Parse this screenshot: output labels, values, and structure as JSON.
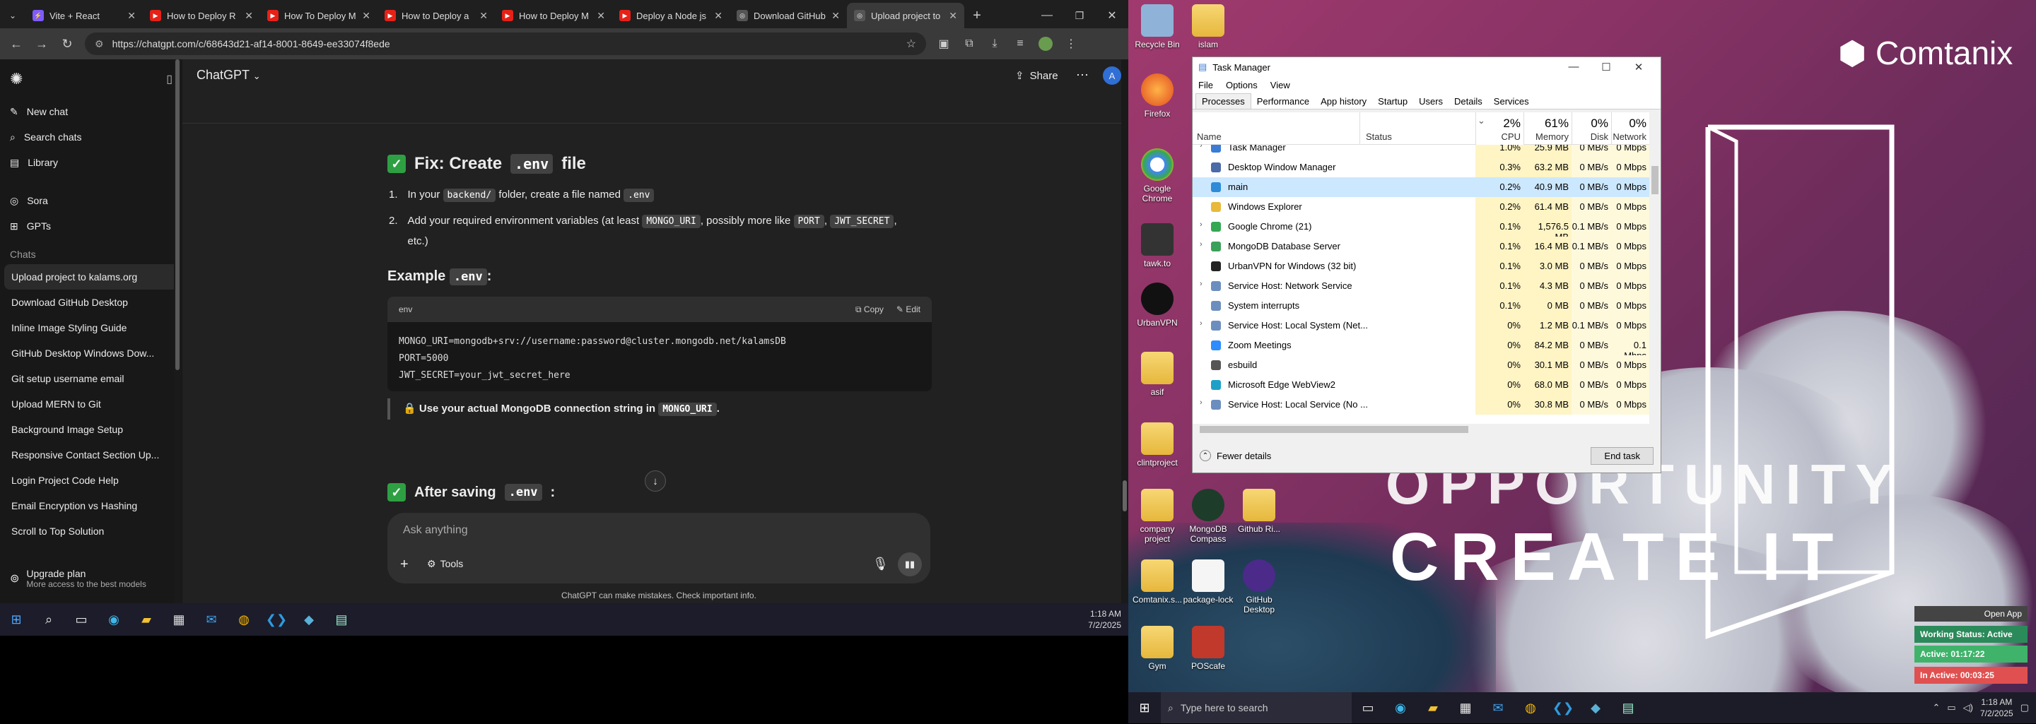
{
  "browser": {
    "tabs": [
      {
        "title": "Vite + React",
        "fav": "vite-icon"
      },
      {
        "title": "How to Deploy R",
        "fav": "youtube-icon"
      },
      {
        "title": "How To Deploy M",
        "fav": "youtube-icon"
      },
      {
        "title": "How to Deploy a",
        "fav": "youtube-icon"
      },
      {
        "title": "How to Deploy M",
        "fav": "youtube-icon"
      },
      {
        "title": "Deploy a Node js",
        "fav": "youtube-icon"
      },
      {
        "title": "Download GitHub",
        "fav": "chatgpt-icon"
      },
      {
        "title": "Upload project to",
        "fav": "chatgpt-icon"
      }
    ],
    "url": "https://chatgpt.com/c/68643d21-af14-8001-8649-ee33074f8ede"
  },
  "sidebar": {
    "new_chat": "New chat",
    "search": "Search chats",
    "library": "Library",
    "sora": "Sora",
    "gpts": "GPTs",
    "chats_heading": "Chats",
    "chats": [
      "Upload project to kalams.org",
      "Download GitHub Desktop",
      "Inline Image Styling Guide",
      "GitHub Desktop Windows Dow...",
      "Git setup username email",
      "Upload MERN to Git",
      "Background Image Setup",
      "Responsive Contact Section Up...",
      "Login Project Code Help",
      "Email Encryption vs Hashing",
      "Scroll to Top Solution"
    ],
    "upgrade_title": "Upgrade plan",
    "upgrade_sub": "More access to the best models"
  },
  "main": {
    "model": "ChatGPT",
    "share": "Share",
    "avatar": "A",
    "fix_title_pre": "Fix: Create",
    "fix_title_code": ".env",
    "fix_title_post": "file",
    "step1_pre": "In your",
    "step1_code": "backend/",
    "step1_mid": "folder, create a file named",
    "step1_code2": ".env",
    "step2_pre": "Add your required environment variables (at least",
    "step2_code1": "MONGO_URI",
    "step2_mid": ", possibly more like",
    "step2_code2": "PORT",
    "step2_code3": "JWT_SECRET",
    "step2_post": ",",
    "step2_cont": "etc.)",
    "example_pre": "Example",
    "example_code": ".env",
    "example_post": ":",
    "code_lang": "env",
    "copy": "Copy",
    "edit": "Edit",
    "code_lines": [
      "MONGO_URI=mongodb+srv://username:password@cluster.mongodb.net/kalamsDB",
      "PORT=5000",
      "JWT_SECRET=your_jwt_secret_here"
    ],
    "note_pre": "Use your actual MongoDB connection string in",
    "note_code": "MONGO_URI",
    "note_post": ".",
    "after_pre": "After saving",
    "after_code": ".env",
    "after_post": ":",
    "composer_placeholder": "Ask anything",
    "tools": "Tools",
    "footer": "ChatGPT can make mistakes. Check important info."
  },
  "taskbar_left": {
    "time": "1:18 AM",
    "date": "7/2/2025"
  },
  "desktop": {
    "logo": "Comtanix",
    "bigtext1": "OPPORTUNITY",
    "bigtext2": "CREATE IT",
    "icons": [
      "Recycle Bin",
      "islam",
      "Firefox",
      "Google Chrome",
      "tawk.to",
      "UrbanVPN",
      "asif",
      "clintproject",
      "company project",
      "MongoDB Compass",
      "Github Ri...",
      "Comtanix.s...",
      "package-lock",
      "GitHub Desktop",
      "Gym",
      "POScafe"
    ]
  },
  "taskmgr": {
    "title": "Task Manager",
    "menu": [
      "File",
      "Options",
      "View"
    ],
    "tabs": [
      "Processes",
      "Performance",
      "App history",
      "Startup",
      "Users",
      "Details",
      "Services"
    ],
    "cols": {
      "name": "Name",
      "status": "Status",
      "cpu_pct": "2%",
      "cpu": "CPU",
      "mem_pct": "61%",
      "mem": "Memory",
      "disk_pct": "0%",
      "disk": "Disk",
      "net_pct": "0%",
      "net": "Network"
    },
    "rows": [
      {
        "name": "Task Manager",
        "cpu": "1.0%",
        "mem": "25.9 MB",
        "disk": "0 MB/s",
        "net": "0 Mbps",
        "exp": "›",
        "color": "#3a7bd5"
      },
      {
        "name": "Desktop Window Manager",
        "cpu": "0.3%",
        "mem": "63.2 MB",
        "disk": "0 MB/s",
        "net": "0 Mbps",
        "exp": "",
        "color": "#4a6aa8"
      },
      {
        "name": "main",
        "cpu": "0.2%",
        "mem": "40.9 MB",
        "disk": "0 MB/s",
        "net": "0 Mbps",
        "exp": "",
        "color": "#2e8bd8"
      },
      {
        "name": "Windows Explorer",
        "cpu": "0.2%",
        "mem": "61.4 MB",
        "disk": "0 MB/s",
        "net": "0 Mbps",
        "exp": "",
        "color": "#e8b93a"
      },
      {
        "name": "Google Chrome (21)",
        "cpu": "0.1%",
        "mem": "1,576.5 MB",
        "disk": "0.1 MB/s",
        "net": "0 Mbps",
        "exp": "›",
        "color": "#34a853"
      },
      {
        "name": "MongoDB Database Server",
        "cpu": "0.1%",
        "mem": "16.4 MB",
        "disk": "0.1 MB/s",
        "net": "0 Mbps",
        "exp": "›",
        "color": "#3aa15a"
      },
      {
        "name": "UrbanVPN for Windows (32 bit)",
        "cpu": "0.1%",
        "mem": "3.0 MB",
        "disk": "0 MB/s",
        "net": "0 Mbps",
        "exp": "",
        "color": "#222"
      },
      {
        "name": "Service Host: Network Service",
        "cpu": "0.1%",
        "mem": "4.3 MB",
        "disk": "0 MB/s",
        "net": "0 Mbps",
        "exp": "›",
        "color": "#6c8ebf"
      },
      {
        "name": "System interrupts",
        "cpu": "0.1%",
        "mem": "0 MB",
        "disk": "0 MB/s",
        "net": "0 Mbps",
        "exp": "",
        "color": "#6c8ebf"
      },
      {
        "name": "Service Host: Local System (Net...",
        "cpu": "0%",
        "mem": "1.2 MB",
        "disk": "0.1 MB/s",
        "net": "0 Mbps",
        "exp": "›",
        "color": "#6c8ebf"
      },
      {
        "name": "Zoom Meetings",
        "cpu": "0%",
        "mem": "84.2 MB",
        "disk": "0 MB/s",
        "net": "0.1 Mbps",
        "exp": "",
        "color": "#2d8cff"
      },
      {
        "name": "esbuild",
        "cpu": "0%",
        "mem": "30.1 MB",
        "disk": "0 MB/s",
        "net": "0 Mbps",
        "exp": "",
        "color": "#555"
      },
      {
        "name": "Microsoft Edge WebView2",
        "cpu": "0%",
        "mem": "68.0 MB",
        "disk": "0 MB/s",
        "net": "0 Mbps",
        "exp": "",
        "color": "#1fa0c8"
      },
      {
        "name": "Service Host: Local Service (No ...",
        "cpu": "0%",
        "mem": "30.8 MB",
        "disk": "0 MB/s",
        "net": "0 Mbps",
        "exp": "›",
        "color": "#6c8ebf"
      }
    ],
    "fewer": "Fewer details",
    "end_task": "End task"
  },
  "widget": {
    "open_app": "Open App",
    "status": "Working Status: Active",
    "active": "Active: 01:17:22",
    "inactive": "In Active: 00:03:25"
  },
  "taskbar_right": {
    "search": "Type here to search",
    "time": "1:18 AM",
    "date": "7/2/2025"
  }
}
